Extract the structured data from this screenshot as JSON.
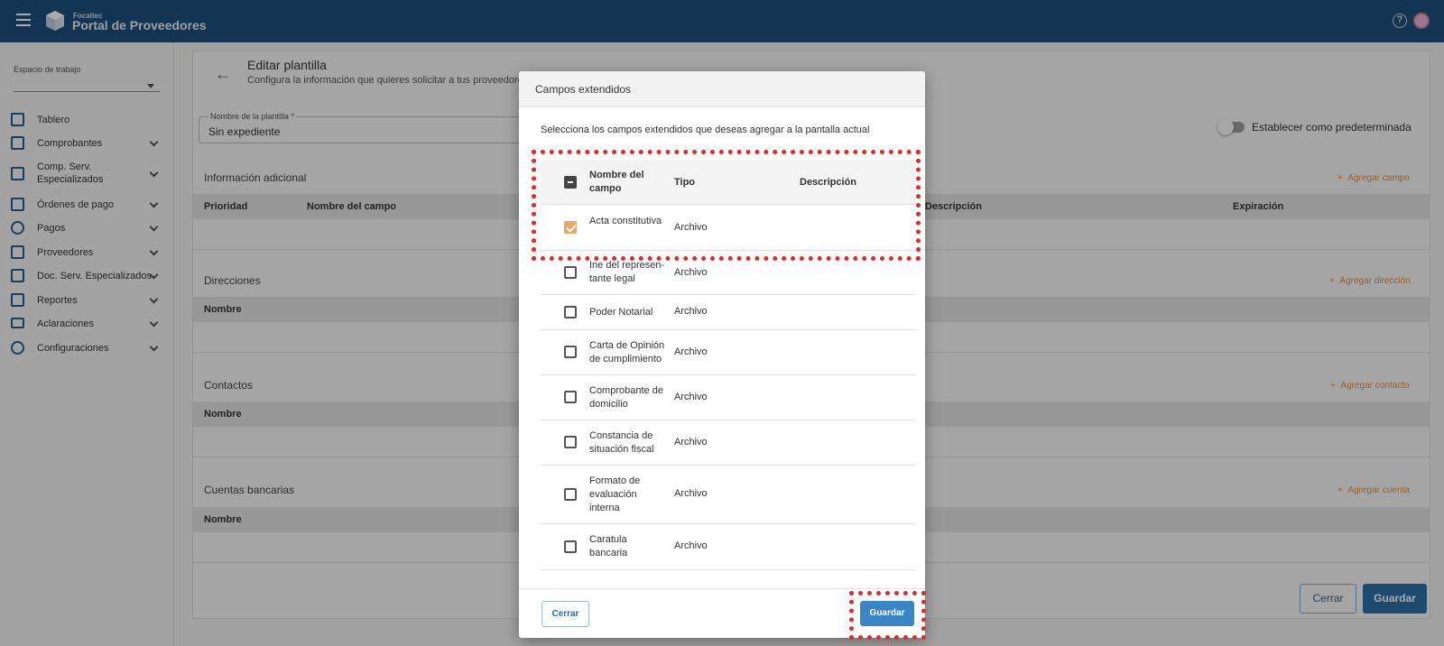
{
  "topbar": {
    "brand_small": "Focaltec",
    "brand_title": "Portal de Proveedores",
    "help_icon": "?"
  },
  "sidebar": {
    "workspace_label": "Espacio de trabajo",
    "workspace_value": "",
    "items": [
      {
        "label": "Tablero",
        "icon": "dashboard-icon"
      },
      {
        "label": "Comprobantes",
        "icon": "document-icon"
      },
      {
        "label": "Comp. Serv. Especializados",
        "icon": "document-icon"
      },
      {
        "label": "Órdenes de pago",
        "icon": "card-icon"
      },
      {
        "label": "Pagos",
        "icon": "dollar-icon"
      },
      {
        "label": "Proveedores",
        "icon": "building-icon"
      },
      {
        "label": "Doc. Serv. Especializados",
        "icon": "checkbox-doc-icon"
      },
      {
        "label": "Reportes",
        "icon": "chart-icon"
      },
      {
        "label": "Aclaraciones",
        "icon": "mail-icon"
      },
      {
        "label": "Configuraciones",
        "icon": "gear-icon"
      }
    ]
  },
  "main": {
    "title": "Editar plantilla",
    "subtitle": "Configura la información que quieres solicitar a tus proveedores",
    "template_name_label": "Nombre de la plantilla *",
    "template_name_value": "Sin expediente",
    "default_toggle_label": "Establecer como predeterminada",
    "sections": {
      "info": {
        "title": "Información adicional",
        "add": "Agregar campo",
        "cols": [
          "Prioridad",
          "Nombre del campo",
          "Descripción",
          "Expiración"
        ]
      },
      "addresses": {
        "title": "Direcciones",
        "add": "Agregar dirección",
        "cols": [
          "Nombre"
        ]
      },
      "contacts": {
        "title": "Contactos",
        "add": "Agregar contacto",
        "cols": [
          "Nombre"
        ]
      },
      "accounts": {
        "title": "Cuentas bancarias",
        "add": "Agregar cuenta",
        "cols": [
          "Nombre"
        ]
      }
    },
    "close_label": "Cerrar",
    "save_label": "Guardar"
  },
  "modal": {
    "title": "Campos extendidos",
    "description": "Selecciona los campos extendidos que deseas agregar a la pantalla actual",
    "headers": {
      "name": "Nombre del campo",
      "type": "Tipo",
      "description": "Descripción"
    },
    "rows": [
      {
        "name": "Acta constitutiva",
        "type": "Archivo",
        "checked": true
      },
      {
        "name": "Ine del represen-tante legal",
        "type": "Archivo",
        "checked": false
      },
      {
        "name": "Poder Notarial",
        "type": "Archivo",
        "checked": false
      },
      {
        "name": "Carta de Opinión de cumplimiento",
        "type": "Archivo",
        "checked": false
      },
      {
        "name": "Comprobante de domicilio",
        "type": "Archivo",
        "checked": false
      },
      {
        "name": "Constancia de situación fiscal",
        "type": "Archivo",
        "checked": false
      },
      {
        "name": "Formato de evaluación interna",
        "type": "Archivo",
        "checked": false
      },
      {
        "name": "Caratula bancaria",
        "type": "Archivo",
        "checked": false
      }
    ],
    "close_label": "Cerrar",
    "save_label": "Guardar"
  }
}
